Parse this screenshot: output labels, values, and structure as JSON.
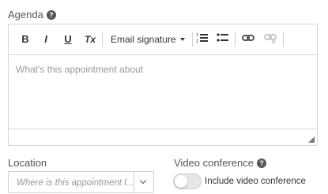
{
  "agenda": {
    "label": "Agenda",
    "help": "?",
    "placeholder": "What's this appointment about",
    "toolbar": {
      "bold": "B",
      "italic": "I",
      "underline": "U",
      "clear_format": "Tx",
      "signature_select": "Email signature"
    }
  },
  "location": {
    "label": "Location",
    "placeholder": "Where is this appointment l..."
  },
  "video": {
    "label": "Video conference",
    "help": "?",
    "toggle_label": "Include video conference",
    "enabled": false
  }
}
